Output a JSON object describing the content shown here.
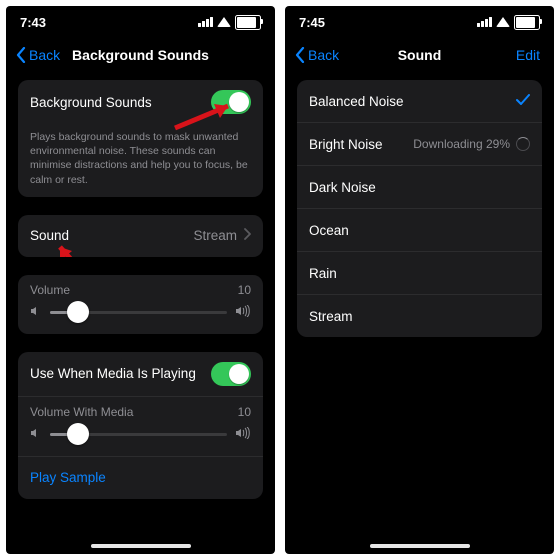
{
  "left": {
    "status": {
      "time": "7:43"
    },
    "nav": {
      "back": "Back",
      "title": "Background Sounds"
    },
    "bg_toggle": {
      "label": "Background Sounds"
    },
    "footnote": "Plays background sounds to mask unwanted environmental noise. These sounds can minimise distractions and help you to focus, be calm or rest.",
    "sound_row": {
      "label": "Sound",
      "value": "Stream"
    },
    "volume": {
      "label": "Volume",
      "value": "10",
      "pct": 16
    },
    "media": {
      "toggle_label": "Use When Media Is Playing",
      "vol_label": "Volume With Media",
      "vol_value": "10",
      "vol_pct": 16,
      "play": "Play Sample"
    }
  },
  "right": {
    "status": {
      "time": "7:45"
    },
    "nav": {
      "back": "Back",
      "title": "Sound",
      "edit": "Edit"
    },
    "list": {
      "i0": {
        "label": "Balanced Noise"
      },
      "i1": {
        "label": "Bright Noise",
        "dl": "Downloading 29%"
      },
      "i2": {
        "label": "Dark Noise"
      },
      "i3": {
        "label": "Ocean"
      },
      "i4": {
        "label": "Rain"
      },
      "i5": {
        "label": "Stream"
      }
    }
  }
}
